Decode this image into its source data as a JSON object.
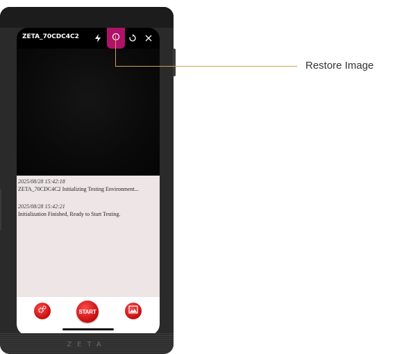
{
  "device": {
    "title": "ZETA_70CDC4C2",
    "brand": "ZETA"
  },
  "icons": {
    "flash": "flash-icon",
    "restore": "circle-icon",
    "rotate": "rotate-icon",
    "close": "close-icon",
    "settings": "gear-icon",
    "gallery": "image-icon"
  },
  "log": {
    "entries": [
      {
        "time": "2025/08/28 15:42:18",
        "message": "ZETA_70CDC4C2 Initializing Testing Environment..."
      },
      {
        "time": "2025/08/28 15:42:21",
        "message": "Initialization Finished, Ready to Start Testing."
      }
    ]
  },
  "controls": {
    "start_label": "START"
  },
  "callout": {
    "label": "Restore Image"
  },
  "colors": {
    "accent": "#b0126a",
    "button_red": "#d91515",
    "log_background": "#eee6e6",
    "callout_line": "#d4a24a"
  }
}
